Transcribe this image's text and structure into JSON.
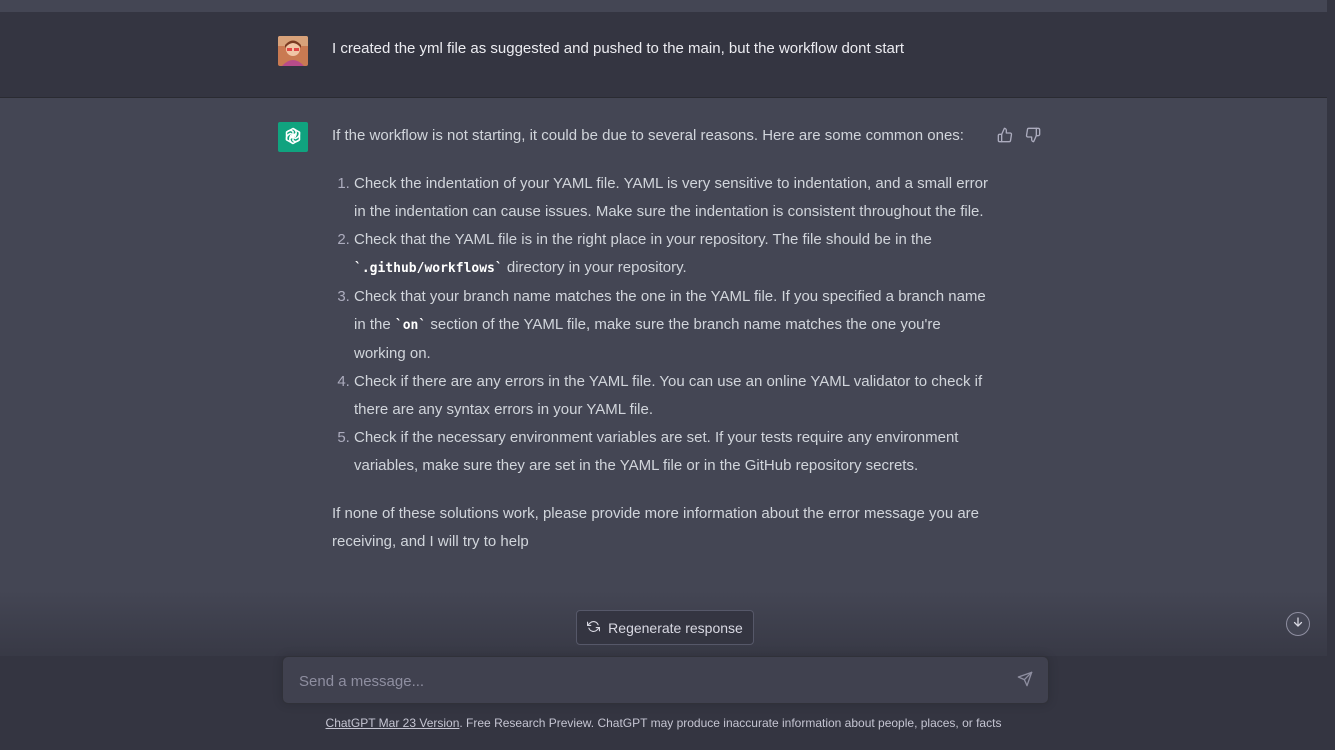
{
  "user_message": {
    "text": "I created the yml file as suggested and pushed to the main, but the workflow dont start",
    "avatar_icon": "user-avatar"
  },
  "assistant_message": {
    "logo_icon": "openai-logo-icon",
    "intro": "If the workflow is not starting, it could be due to several reasons. Here are some common ones:",
    "items": [
      {
        "text": "Check the indentation of your YAML file. YAML is very sensitive to indentation, and a small error in the indentation can cause issues. Make sure the indentation is consistent throughout the file."
      },
      {
        "pre": "Check that the YAML file is in the right place in your repository. The file should be in the ",
        "code": "`.github/workflows`",
        "post": " directory in your repository."
      },
      {
        "pre": "Check that your branch name matches the one in the YAML file. If you specified a branch name in the ",
        "code": "`on`",
        "post": " section of the YAML file, make sure the branch name matches the one you're working on."
      },
      {
        "text": "Check if there are any errors in the YAML file. You can use an online YAML validator to check if there are any syntax errors in your YAML file."
      },
      {
        "text": "Check if the necessary environment variables are set. If your tests require any environment variables, make sure they are set in the YAML file or in the GitHub repository secrets."
      }
    ],
    "outro": "If none of these solutions work, please provide more information about the error message you are receiving, and I will try to help"
  },
  "actions": {
    "thumbs_up_icon": "thumbs-up-icon",
    "thumbs_down_icon": "thumbs-down-icon",
    "regenerate_label": "Regenerate response",
    "regenerate_icon": "refresh-icon",
    "scroll_down_icon": "arrow-down-icon"
  },
  "composer": {
    "placeholder": "Send a message...",
    "value": "",
    "send_icon": "send-icon"
  },
  "footer": {
    "link_text": "ChatGPT Mar 23 Version",
    "text": ". Free Research Preview. ChatGPT may produce inaccurate information about people, places, or facts"
  },
  "colors": {
    "background_assistant": "#444654",
    "background_user": "#343541",
    "accent": "#10a37f"
  }
}
